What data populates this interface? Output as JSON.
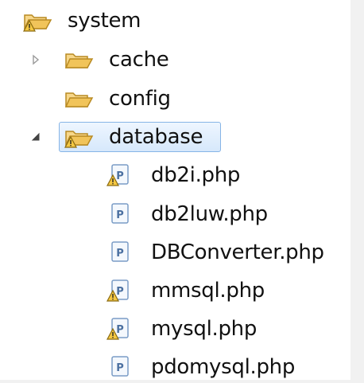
{
  "tree": {
    "root": {
      "label": "system",
      "icon": "folder-open-warning-icon",
      "expanded": true
    },
    "items": [
      {
        "label": "cache",
        "icon": "folder-open-icon",
        "twisty": "collapsed"
      },
      {
        "label": "config",
        "icon": "folder-open-icon",
        "twisty": "none"
      },
      {
        "label": "database",
        "icon": "folder-open-warning-icon",
        "twisty": "expanded",
        "selected": true
      },
      {
        "label": "db2i.php",
        "icon": "php-file-warning-icon"
      },
      {
        "label": "db2luw.php",
        "icon": "php-file-icon"
      },
      {
        "label": "DBConverter.php",
        "icon": "php-file-icon"
      },
      {
        "label": "mmsql.php",
        "icon": "php-file-warning-icon"
      },
      {
        "label": "mysql.php",
        "icon": "php-file-warning-icon"
      },
      {
        "label": "pdomysql.php",
        "icon": "php-file-icon"
      }
    ],
    "colors": {
      "folder": "#e9b84a",
      "warning": "#f2c12e",
      "php_file_border": "#7a9cc6",
      "selection_border": "#86b4e6"
    }
  }
}
